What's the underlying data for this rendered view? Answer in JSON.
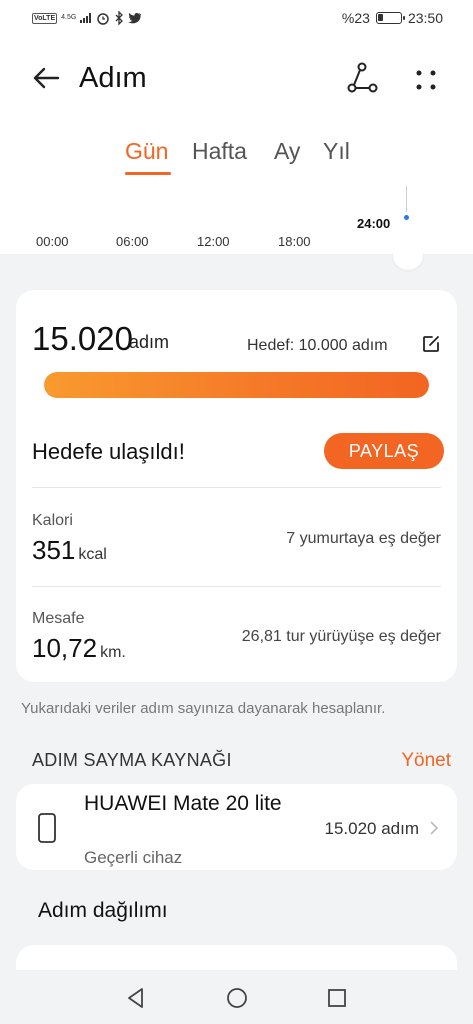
{
  "status_bar": {
    "volte": "VoLTE",
    "network": "4.5G",
    "battery_text": "%23",
    "battery_level": 0.23,
    "time": "23:50"
  },
  "header": {
    "title": "Adım",
    "icons": [
      "back-arrow-icon",
      "route-icon",
      "more-icon"
    ]
  },
  "tabs": [
    {
      "label": "Gün",
      "active": true
    },
    {
      "label": "Hafta",
      "active": false
    },
    {
      "label": "Ay",
      "active": false
    },
    {
      "label": "Yıl",
      "active": false
    }
  ],
  "timeline": {
    "ticks": [
      "00:00",
      "06:00",
      "12:00",
      "18:00"
    ],
    "current": "24:00"
  },
  "summary": {
    "steps": "15.020",
    "steps_unit": "adım",
    "goal": "Hedef: 10.000 adım",
    "progress": 1.0,
    "goal_reached": "Hedefe ulaşıldı!",
    "share_label": "PAYLAŞ",
    "calories": {
      "label": "Kalori",
      "value": "351",
      "unit": "kcal",
      "equivalent": "7 yumurtaya eş değer"
    },
    "distance": {
      "label": "Mesafe",
      "value": "10,72",
      "unit": "km.",
      "equivalent": "26,81 tur yürüyüşe eş değer"
    }
  },
  "note": "Yukarıdaki veriler adım sayınıza dayanarak hesaplanır.",
  "source_section": {
    "title": "ADIM SAYMA KAYNAĞI",
    "manage_label": "Yönet",
    "device": {
      "name": "HUAWEI Mate 20 lite",
      "status": "Geçerli cihaz",
      "steps": "15.020 adım"
    }
  },
  "distribution": {
    "title": "Adım dağılımı"
  },
  "colors": {
    "accent": "#f26522",
    "background": "#f1f3f5",
    "card": "#ffffff"
  }
}
